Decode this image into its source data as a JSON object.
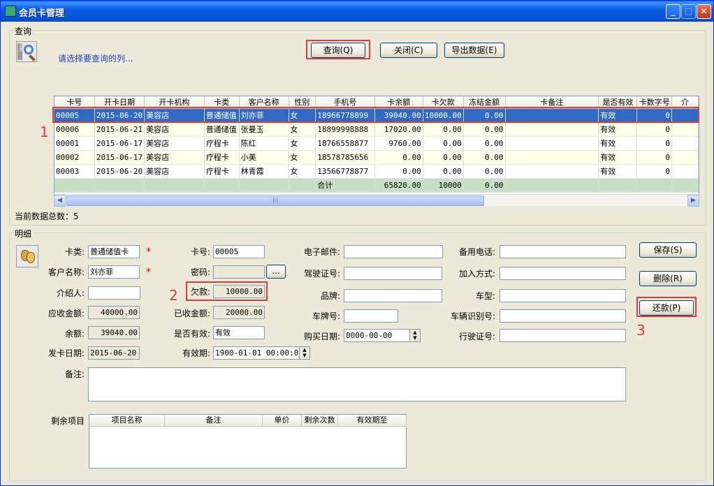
{
  "window": {
    "title": "会员卡管理"
  },
  "query": {
    "group_title": "查询",
    "hint": "请选择要查询的列...",
    "btn_query": "查询(Q)",
    "btn_close": "关闭(C)",
    "btn_export": "导出数据(E)",
    "total_label": "当前数据总数：5"
  },
  "grid": {
    "columns": [
      "卡号",
      "开卡日期",
      "开卡机构",
      "卡类",
      "客户名称",
      "性别",
      "手机号",
      "卡余额",
      "卡欠款",
      "冻结金额",
      "卡备注",
      "是否有效",
      "卡数字号",
      "介"
    ],
    "rows": [
      [
        "00005",
        "2015-06-20",
        "美容店",
        "普通储值",
        "刘亦菲",
        "女",
        "18966778899",
        "39040.00",
        "10000.00",
        "0.00",
        "",
        "有效",
        "0",
        ""
      ],
      [
        "00006",
        "2015-06-21",
        "美容店",
        "普通储值",
        "张曼玉",
        "女",
        "18899998888",
        "17020.00",
        "0.00",
        "0.00",
        "",
        "有效",
        "0",
        ""
      ],
      [
        "00001",
        "2015-06-17",
        "美容店",
        "疗程卡",
        "陈红",
        "女",
        "18766558877",
        "9760.00",
        "0.00",
        "0.00",
        "",
        "有效",
        "0",
        ""
      ],
      [
        "00002",
        "2015-06-17",
        "美容店",
        "疗程卡",
        "小美",
        "女",
        "18578785656",
        "0.00",
        "0.00",
        "0.00",
        "",
        "有效",
        "0",
        ""
      ],
      [
        "00003",
        "2015-06-20",
        "美容店",
        "疗程卡",
        "林青霞",
        "女",
        "13566778877",
        "0.00",
        "0.00",
        "0.00",
        "",
        "有效",
        "0",
        ""
      ]
    ],
    "sum_row": [
      "",
      "",
      "",
      "",
      "",
      "",
      "合计",
      "65820.00",
      "10000",
      "0.00",
      "",
      "",
      "",
      ""
    ]
  },
  "detail": {
    "group_title": "明细",
    "card_type_label": "卡类:",
    "card_type": "普通储值卡",
    "customer_label": "客户名称:",
    "customer": "刘亦菲",
    "referrer_label": "介绍人:",
    "referrer": "",
    "receivable_label": "应收金额:",
    "receivable": "40000.00",
    "balance_label": "余额:",
    "balance": "39040.00",
    "issue_date_label": "发卡日期:",
    "issue_date": "2015-06-20",
    "card_no_label": "卡号:",
    "card_no": "00005",
    "password_label": "密码:",
    "password": "",
    "browse_btn": "...",
    "debt_label": "欠款:",
    "debt": "10000.00",
    "received_label": "已收金额:",
    "received": "20000.00",
    "valid_label": "是否有效:",
    "valid": "有效",
    "expiry_label": "有效期:",
    "expiry": "1900-01-01 00:00:00",
    "email_label": "电子邮件:",
    "email": "",
    "license_label": "驾驶证号:",
    "license": "",
    "brand_label": "品牌:",
    "brand": "",
    "plate_label": "车牌号:",
    "plate": "",
    "purchase_date_label": "购买日期:",
    "purchase_date": "0000-00-00",
    "backup_phone_label": "备用电话:",
    "backup_phone": "",
    "join_method_label": "加入方式:",
    "join_method": "",
    "car_model_label": "车型:",
    "car_model": "",
    "vin_label": "车辆识别号:",
    "vin": "",
    "driving_permit_label": "行驶证号:",
    "driving_permit": "",
    "remark_label": "备注:",
    "remark": "",
    "btn_save": "保存(S)",
    "btn_delete": "删除(R)",
    "btn_repay": "还款(P)",
    "remaining_label": "剩余项目",
    "remaining_columns": [
      "项目名称",
      "备注",
      "单价",
      "剩余次数",
      "有效期至"
    ]
  },
  "annotations": [
    "1",
    "2",
    "3"
  ]
}
